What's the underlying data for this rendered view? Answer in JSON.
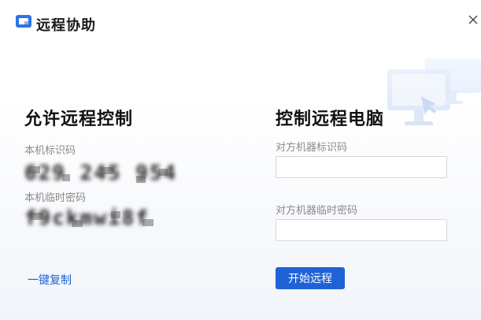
{
  "window": {
    "title": "远程协助",
    "close_icon": "close-icon",
    "app_icon": "remote-assist-icon",
    "accent_color": "#1e62d6"
  },
  "allow_panel": {
    "title": "允许远程控制",
    "device_id_label": "本机标识码",
    "device_id_value": "629 245 954",
    "temp_password_label": "本机临时密码",
    "temp_password_value": "f9ckmwi8f",
    "copy_link": "一键复制"
  },
  "control_panel": {
    "title": "控制远程电脑",
    "remote_id_label": "对方机器标识码",
    "remote_id_value": "",
    "remote_password_label": "对方机器临时密码",
    "remote_password_value": "",
    "start_button": "开始远程"
  }
}
